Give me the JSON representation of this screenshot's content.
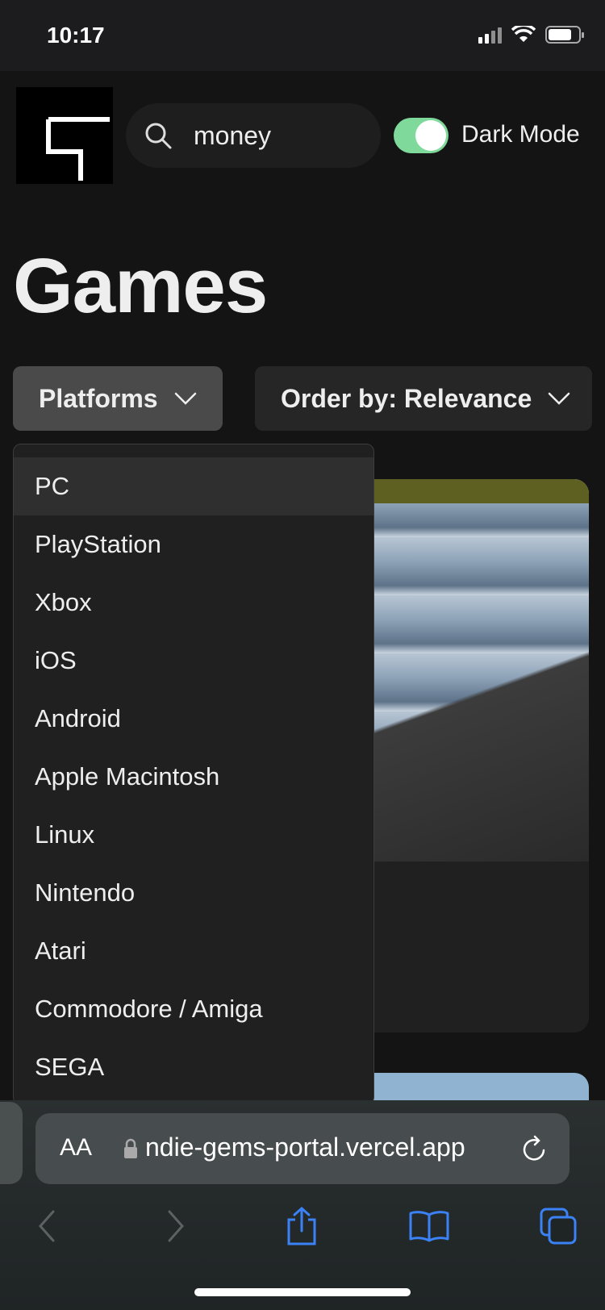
{
  "status_bar": {
    "time": "10:17"
  },
  "header": {
    "search": {
      "value": "money",
      "placeholder": ""
    },
    "dark_mode": {
      "label": "Dark Mode",
      "enabled": true
    }
  },
  "page": {
    "title": "Games"
  },
  "filters": {
    "platforms_label": "Platforms",
    "order_label": "Order by: Relevance"
  },
  "platforms_menu": {
    "items": [
      "PC",
      "PlayStation",
      "Xbox",
      "iOS",
      "Android",
      "Apple Macintosh",
      "Linux",
      "Nintendo",
      "Atari",
      "Commodore / Amiga",
      "SEGA"
    ],
    "highlighted": "PC"
  },
  "browser": {
    "aa_label": "AA",
    "url": "ndie-gems-portal.vercel.app"
  },
  "colors": {
    "background": "#141414",
    "toggle_on": "#7fd99a",
    "safari_accent": "#3b82f6"
  }
}
